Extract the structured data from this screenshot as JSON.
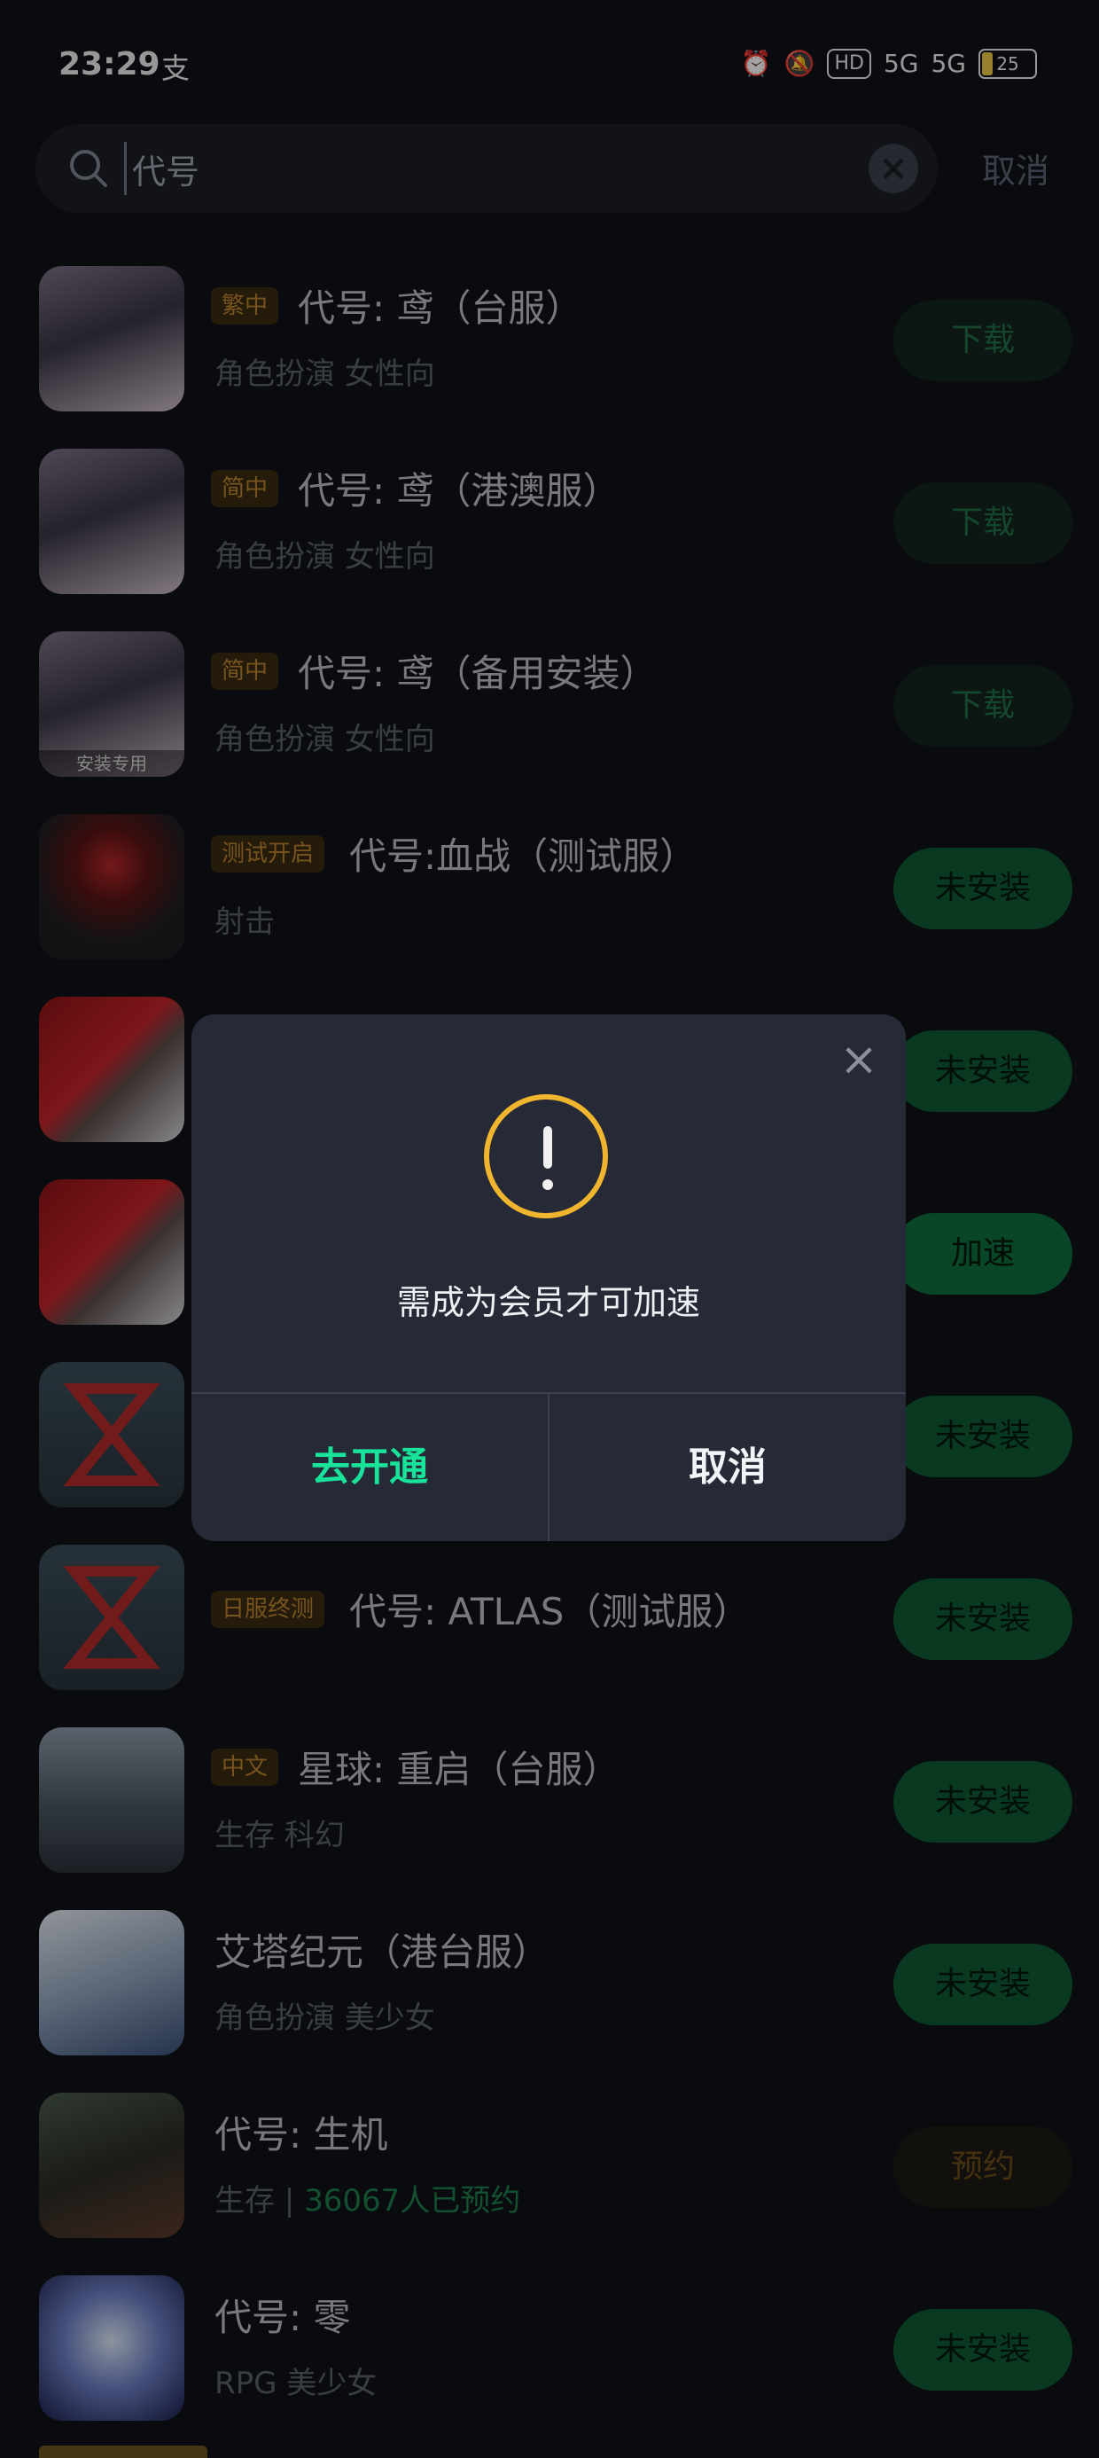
{
  "status_bar": {
    "time": "23:29",
    "extra_glyph": "支",
    "icons": [
      "alarm-icon",
      "mute-icon",
      "hd-icon",
      "5g-signal-icon",
      "5g-signal-icon"
    ],
    "hd_label": "HD",
    "net1": "5G",
    "net2": "5G",
    "battery": "25"
  },
  "search": {
    "value": "代号",
    "cancel_label": "取消"
  },
  "colors": {
    "background": "#0f1117",
    "accent_green": "#19e39a",
    "warning": "#f0b52e",
    "tag_bg": "#3a2a12",
    "tag_text": "#b7802d"
  },
  "apps": [
    {
      "tag": "繁中",
      "title": "代号: 鸢（台服）",
      "sub": "角色扮演  女性向",
      "button": "下载"
    },
    {
      "tag": "简中",
      "title": "代号: 鸢（港澳服）",
      "sub": "角色扮演  女性向",
      "button": "下载"
    },
    {
      "tag": "简中",
      "title": "代号: 鸢（备用安装）",
      "sub": "角色扮演  女性向",
      "button": "下载",
      "icon_caption": "安装专用"
    },
    {
      "tag": "测试开启",
      "title": "代号:血战（测试服）",
      "sub": "射击",
      "button": "未安装"
    },
    {
      "button": "未安装"
    },
    {
      "button": "加速"
    },
    {
      "button": "未安装"
    },
    {
      "tag": "日服终测",
      "title": "代号: ATLAS（测试服）",
      "button": "未安装"
    },
    {
      "tag": "中文",
      "title": "星球: 重启（台服）",
      "sub": "生存  科幻",
      "button": "未安装"
    },
    {
      "title": "艾塔纪元（港台服）",
      "sub": "角色扮演  美少女",
      "button": "未安装"
    },
    {
      "title": "代号: 生机",
      "sub": "生存 | ",
      "sub_highlight": "36067人已预约",
      "button": "预约"
    },
    {
      "title": "代号: 零",
      "sub": "RPG  美少女",
      "button": "未安装"
    }
  ],
  "dialog": {
    "message": "需成为会员才可加速",
    "confirm_label": "去开通",
    "cancel_label": "取消"
  }
}
